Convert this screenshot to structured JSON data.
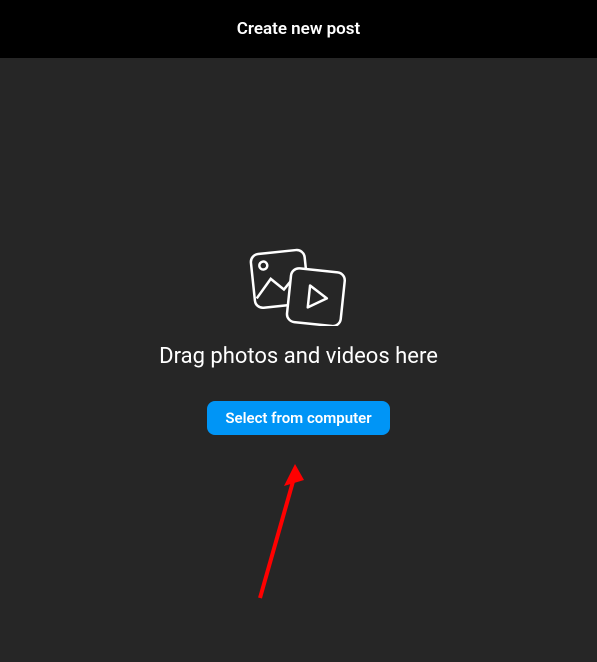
{
  "header": {
    "title": "Create new post"
  },
  "main": {
    "drag_text": "Drag photos and videos here",
    "select_button_label": "Select from computer"
  },
  "colors": {
    "accent": "#0095f6",
    "background": "#262626",
    "header_bg": "#000000",
    "annotation": "#ff0000"
  }
}
